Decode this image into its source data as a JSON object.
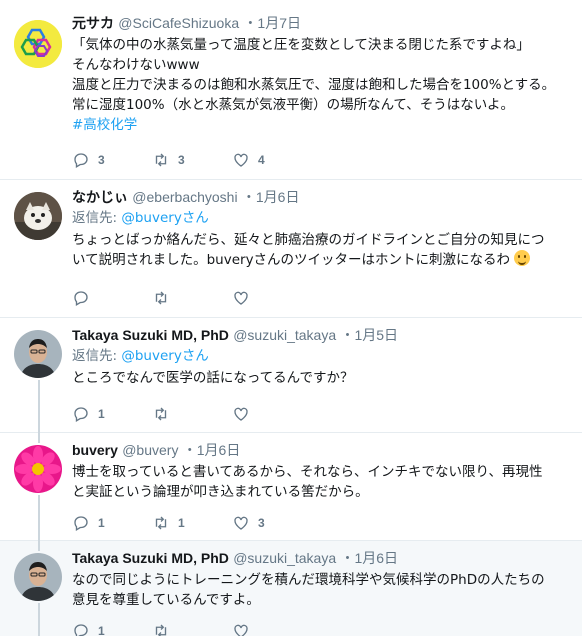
{
  "colors": {
    "link": "#1da1f2",
    "muted": "#657786",
    "text": "#14171a",
    "thread": "#ccd6dd",
    "highlight_bg": "#f5f8fa"
  },
  "tweets": [
    {
      "fullname": "元サカ",
      "username": "@SciCafeShizuoka",
      "dot": "・",
      "time": "1月7日",
      "lines": [
        "「気体の中の水蒸気量って温度と圧を変数として決まる閉じた系ですよね」",
        "そんなわけないwww",
        "温度と圧力で決まるのは飽和水蒸気圧で、湿度は飽和した場合を100%とする。",
        "常に湿度100%（水と水蒸気が気液平衡）の場所なんて、そうはないよ。"
      ],
      "hashtag": "#高校化学",
      "reply_count": "3",
      "retweet_count": "3",
      "like_count": "4"
    },
    {
      "fullname": "なかじぃ",
      "username": "@eberbachyoshi",
      "dot": "・",
      "time": "1月6日",
      "replying_label": "返信先: ",
      "replying_link": "@buvery",
      "replying_suffix": "さん",
      "lines": [
        "ちょっとばっか絡んだら、延々と肺癌治療のガイドラインとご自分の知見につ",
        "いて説明されました。buveryさんのツイッターはホントに刺激になるわ"
      ],
      "reply_count": "",
      "retweet_count": "",
      "like_count": ""
    },
    {
      "fullname": "Takaya Suzuki MD, PhD",
      "username": "@suzuki_takaya",
      "dot": "・",
      "time": "1月5日",
      "replying_label": "返信先: ",
      "replying_link": "@buvery",
      "replying_suffix": "さん",
      "lines": [
        "ところでなんで医学の話になってるんですか？"
      ],
      "reply_count": "1",
      "retweet_count": "",
      "like_count": ""
    },
    {
      "fullname": "buvery",
      "username": "@buvery",
      "dot": "・",
      "time": "1月6日",
      "lines": [
        "博士を取っていると書いてあるから、それなら、インチキでない限り、再現性",
        "と実証という論理が叩き込まれている筈だから。"
      ],
      "reply_count": "1",
      "retweet_count": "1",
      "like_count": "3"
    },
    {
      "fullname": "Takaya Suzuki MD, PhD",
      "username": "@suzuki_takaya",
      "dot": "・",
      "time": "1月6日",
      "lines": [
        "なので同じようにトレーニングを積んだ環境科学や気候科学のPhDの人たちの",
        "意見を尊重しているんですよ。"
      ],
      "reply_count": "1",
      "retweet_count": "",
      "like_count": ""
    }
  ]
}
